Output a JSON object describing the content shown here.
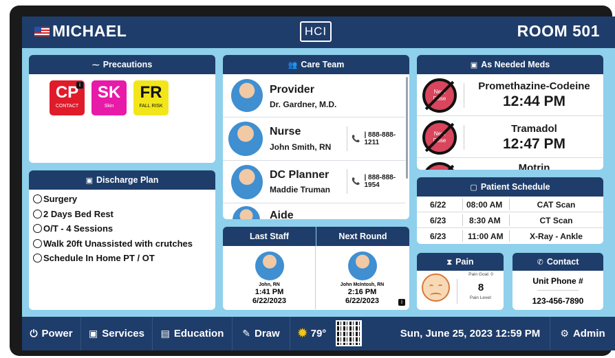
{
  "header": {
    "patient_name": "MICHAEL",
    "logo": "HCI",
    "room": "ROOM 501"
  },
  "precautions": {
    "title": "Precautions",
    "items": [
      {
        "code": "CP",
        "sub": "CONTACT",
        "color": "#e01b2a",
        "info": "i"
      },
      {
        "code": "SK",
        "sub": "Skin",
        "color": "#e81aa8"
      },
      {
        "code": "FR",
        "sub": "FALL RISK",
        "color": "#f2e61a"
      }
    ]
  },
  "discharge": {
    "title": "Discharge Plan",
    "items": [
      "Surgery",
      "2 Days Bed Rest",
      "O/T - 4 Sessions",
      "Walk 20ft Unassisted with crutches",
      "Schedule In Home PT / OT"
    ]
  },
  "care_team": {
    "title": "Care Team",
    "members": [
      {
        "role": "Provider",
        "name": "Dr. Gardner, M.D.",
        "phone": ""
      },
      {
        "role": "Nurse",
        "name": "John Smith, RN",
        "phone": "| 888-888-1211"
      },
      {
        "role": "DC Planner",
        "name": "Maddie Truman",
        "phone": "| 888-888-1954"
      },
      {
        "role": "Aide",
        "name": "",
        "phone": ""
      }
    ]
  },
  "rounds": {
    "last_label": "Last Staff",
    "next_label": "Next Round",
    "last": {
      "name": "John, RN",
      "time": "1:41 PM",
      "date": "6/22/2023"
    },
    "next": {
      "name": "John McIntosh, RN",
      "time": "2:16 PM",
      "date": "6/22/2023"
    },
    "info": "i"
  },
  "meds": {
    "title": "As Needed Meds",
    "badge_text": "Next\nDose",
    "items": [
      {
        "name": "Promethazine-Codeine",
        "time": "12:44 PM"
      },
      {
        "name": "Tramadol",
        "time": "12:47 PM"
      },
      {
        "name": "Motrin",
        "time": ""
      }
    ]
  },
  "schedule": {
    "title": "Patient Schedule",
    "rows": [
      {
        "date": "6/22",
        "time": "08:00 AM",
        "event": "CAT Scan"
      },
      {
        "date": "6/23",
        "time": "8:30 AM",
        "event": "CT Scan"
      },
      {
        "date": "6/23",
        "time": "11:00 AM",
        "event": "X-Ray - Ankle"
      }
    ]
  },
  "pain": {
    "title": "Pain",
    "goal": "Pain Goal: 0",
    "value": "8",
    "level_label": "Pain Level:"
  },
  "contact": {
    "title": "Contact",
    "label": "Unit Phone #",
    "phone": "123-456-7890"
  },
  "footer": {
    "power": "Power",
    "services": "Services",
    "education": "Education",
    "draw": "Draw",
    "temperature": "79°",
    "datetime": "Sun, June 25, 2023 12:59 PM",
    "admin": "Admin"
  },
  "colors": {
    "navy": "#1f3d6b",
    "background": "#8fd0ec",
    "phone_green": "#1b8a3a"
  }
}
